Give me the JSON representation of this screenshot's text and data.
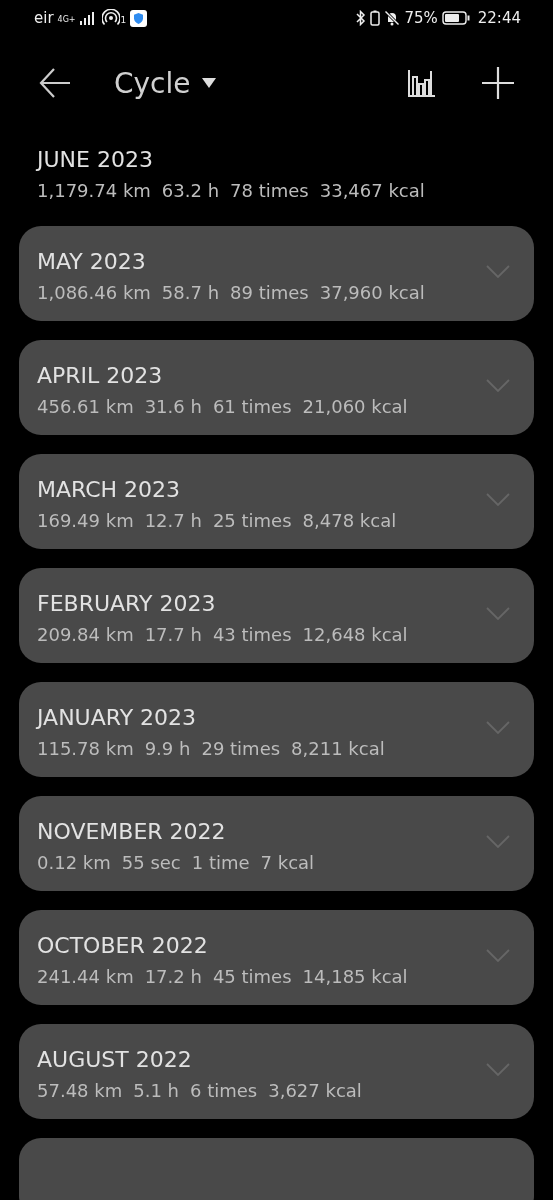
{
  "status_bar": {
    "carrier": "eir",
    "network": "4G+",
    "hotspot_count": "1",
    "battery": "75%",
    "time": "22:44"
  },
  "header": {
    "title": "Cycle"
  },
  "months": [
    {
      "title": "JUNE 2023",
      "expanded": true,
      "stats": [
        "1,179.74 km",
        "63.2 h",
        "78 times",
        "33,467 kcal"
      ]
    },
    {
      "title": "MAY 2023",
      "expanded": false,
      "stats": [
        "1,086.46 km",
        "58.7 h",
        "89 times",
        "37,960 kcal"
      ]
    },
    {
      "title": "APRIL 2023",
      "expanded": false,
      "stats": [
        "456.61 km",
        "31.6 h",
        "61 times",
        "21,060 kcal"
      ]
    },
    {
      "title": "MARCH 2023",
      "expanded": false,
      "stats": [
        "169.49 km",
        "12.7 h",
        "25 times",
        "8,478 kcal"
      ]
    },
    {
      "title": "FEBRUARY 2023",
      "expanded": false,
      "stats": [
        "209.84 km",
        "17.7 h",
        "43 times",
        "12,648 kcal"
      ]
    },
    {
      "title": "JANUARY 2023",
      "expanded": false,
      "stats": [
        "115.78 km",
        "9.9 h",
        "29 times",
        "8,211 kcal"
      ]
    },
    {
      "title": "NOVEMBER 2022",
      "expanded": false,
      "stats": [
        "0.12 km",
        "55 sec",
        "1 time",
        "7 kcal"
      ]
    },
    {
      "title": "OCTOBER 2022",
      "expanded": false,
      "stats": [
        "241.44 km",
        "17.2 h",
        "45 times",
        "14,185 kcal"
      ]
    },
    {
      "title": "AUGUST 2022",
      "expanded": false,
      "stats": [
        "57.48 km",
        "5.1 h",
        "6 times",
        "3,627 kcal"
      ]
    }
  ]
}
